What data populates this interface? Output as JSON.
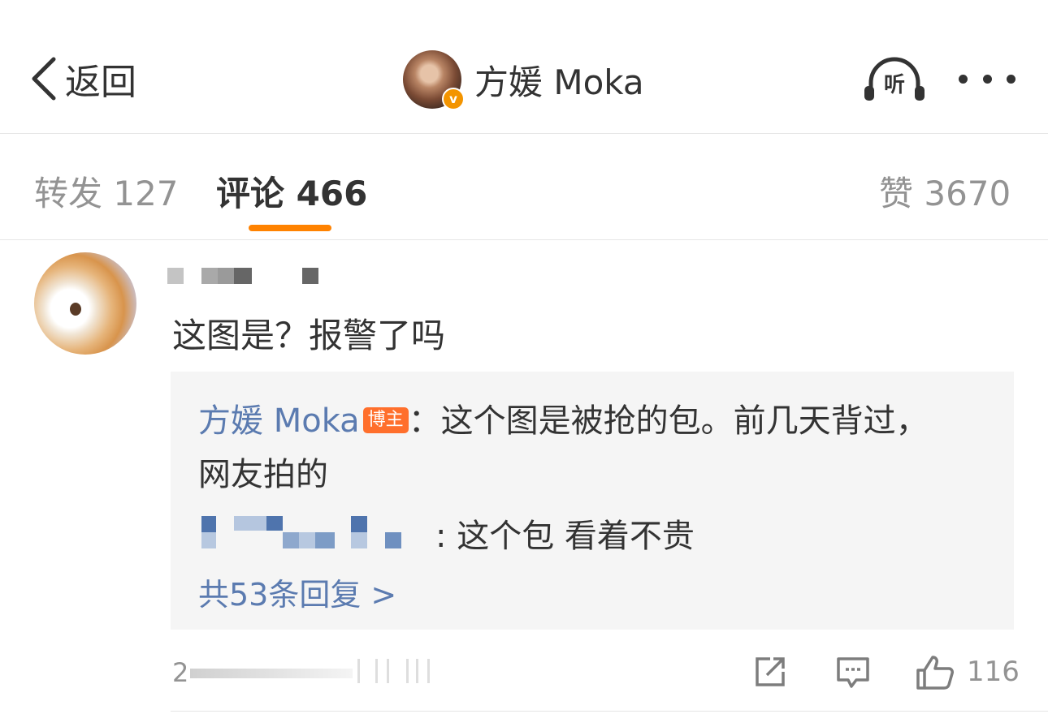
{
  "nav": {
    "back_label": "返回",
    "author_name": "方媛 Moka",
    "verified_mark": "v",
    "listen_label": "听"
  },
  "tabs": {
    "repost": "转发 127",
    "comment": "评论 466",
    "like": "赞 3670",
    "active": "comment"
  },
  "comment": {
    "text": "这图是？报警了吗",
    "time_visible": "2",
    "replies": [
      {
        "author": "方媛 Moka",
        "badge": "博主",
        "text": "：这个图是被抢的包。前几天背过，网友拍的"
      },
      {
        "text": ": 这个包 看着不贵"
      }
    ],
    "more_replies": "共53条回复 >",
    "like_count": "116"
  },
  "colors": {
    "accent": "#ff8200",
    "link": "#5b7bb0",
    "badge": "#ff6f2c",
    "verified": "#f39400"
  }
}
